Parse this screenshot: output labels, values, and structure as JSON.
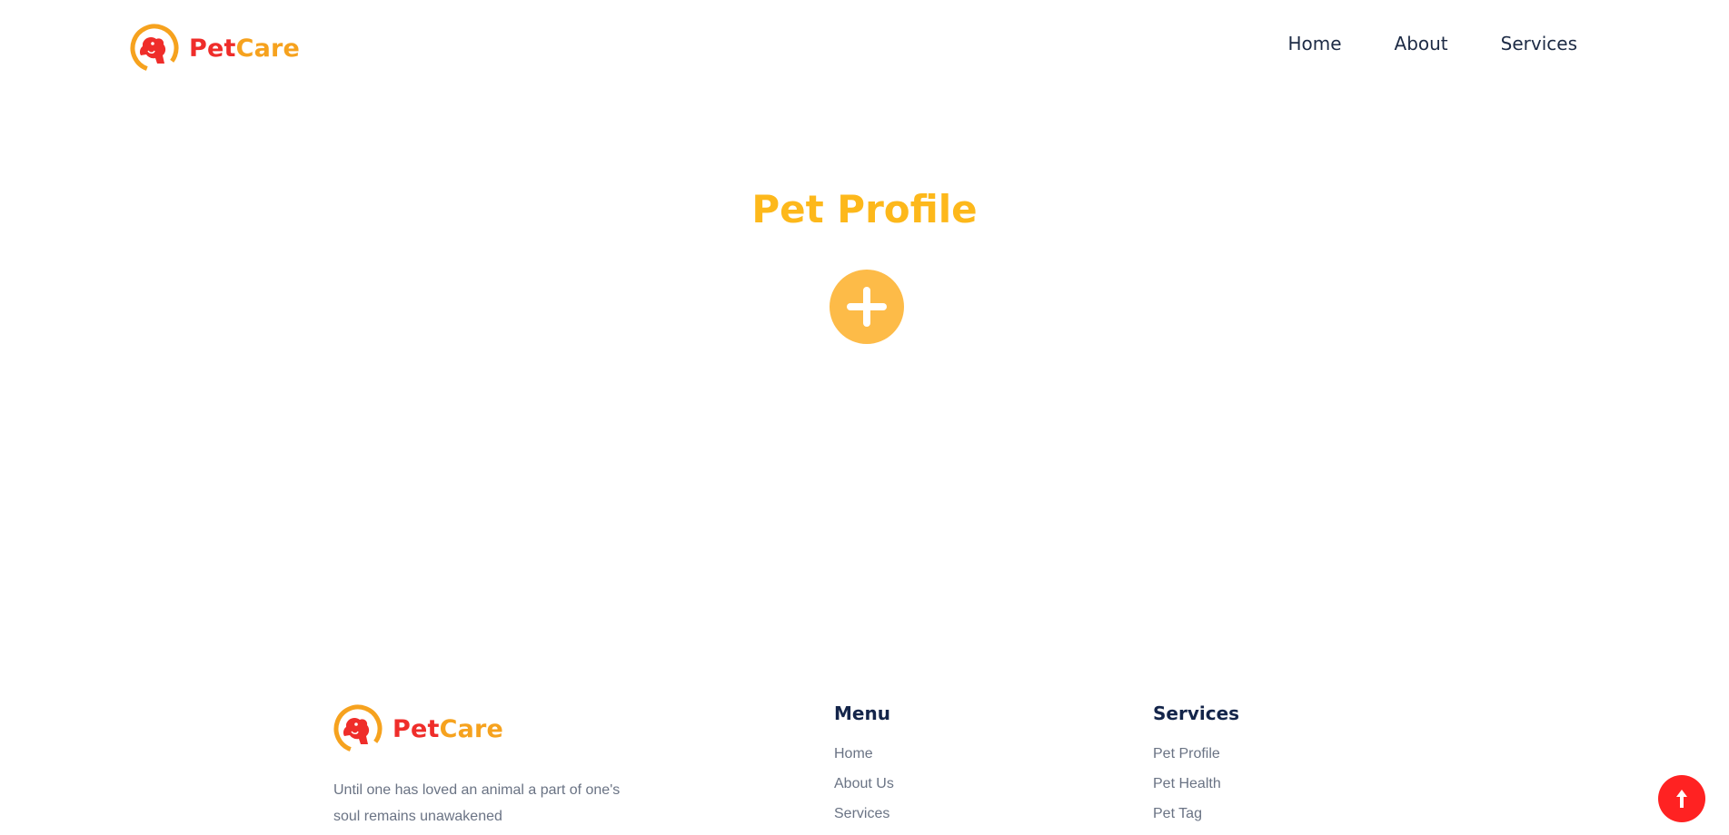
{
  "header": {
    "logo": {
      "text_pet": "Pet",
      "text_care": "Care"
    },
    "nav": [
      {
        "label": "Home"
      },
      {
        "label": "About"
      },
      {
        "label": "Services"
      }
    ]
  },
  "main": {
    "title": "Pet Profile",
    "add_button_icon": "plus-icon"
  },
  "footer": {
    "logo": {
      "text_pet": "Pet",
      "text_care": "Care"
    },
    "tagline": "Until one has loved an animal a part of one's soul remains unawakened",
    "menu": {
      "heading": "Menu",
      "links": [
        {
          "label": "Home"
        },
        {
          "label": "About Us"
        },
        {
          "label": "Services"
        }
      ]
    },
    "services": {
      "heading": "Services",
      "links": [
        {
          "label": "Pet Profile"
        },
        {
          "label": "Pet Health"
        },
        {
          "label": "Pet Tag"
        }
      ]
    }
  },
  "scroll_top": {
    "icon": "arrow-up-icon"
  },
  "colors": {
    "brand_red": "#ef2d2a",
    "brand_orange": "#f6a21e",
    "title_yellow": "#fdb81b",
    "add_button": "#fdbb48",
    "nav_text": "#1d2b45",
    "footer_heading": "#14254a",
    "footer_text": "#6a7384",
    "scroll_top": "#ff2222"
  }
}
